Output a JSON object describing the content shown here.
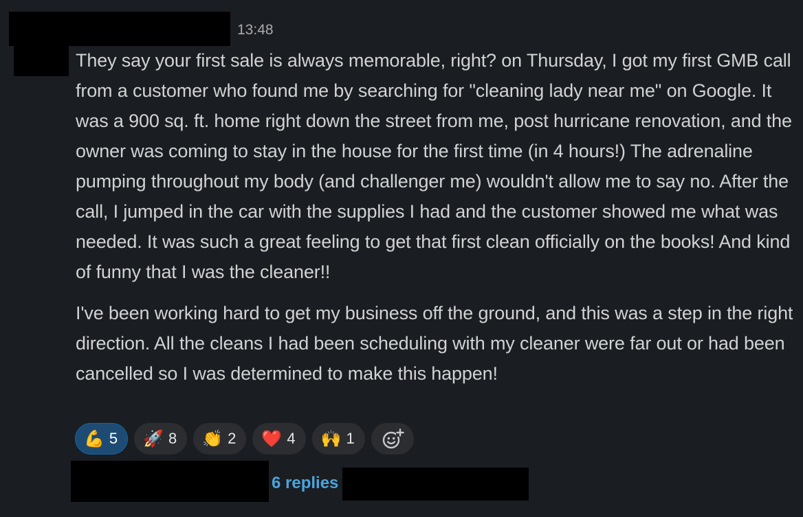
{
  "message": {
    "timestamp": "13:48",
    "paragraphs": [
      "They say your first sale is always memorable, right? on Thursday, I got my first GMB call from a customer who found me by searching for \"cleaning lady near me\" on Google. It was a 900 sq. ft. home right down the street from me, post hurricane renovation, and the owner was coming to stay in the house for the first time (in 4 hours!) The adrenaline pumping throughout my body (and challenger me) wouldn't allow me to say no. After the call, I jumped in the car with the supplies I had and the customer showed me what was needed. It was such a great feeling to get that first clean officially on the books! And kind of funny that I was the cleaner!!",
      "I've been working hard to get my business off the ground, and this was a step in the right direction. All the cleans I had been scheduling with my cleaner were far out or had been cancelled so I was determined to make this happen!"
    ]
  },
  "reactions": [
    {
      "emoji": "💪",
      "name": "flexed-biceps",
      "count": "5",
      "active": true
    },
    {
      "emoji": "🚀",
      "name": "rocket",
      "count": "8",
      "active": false
    },
    {
      "emoji": "👏",
      "name": "clapping-hands",
      "count": "2",
      "active": false
    },
    {
      "emoji": "❤️",
      "name": "red-heart",
      "count": "4",
      "active": false
    },
    {
      "emoji": "🙌",
      "name": "raising-hands",
      "count": "1",
      "active": false
    }
  ],
  "add_reaction_icon": "add-emoji-icon",
  "thread": {
    "replies_label": "6 replies"
  },
  "colors": {
    "background": "#1a1d21",
    "text": "#d1d2d3",
    "link": "#4aa5dd",
    "active_reaction": "#1d4b74"
  }
}
